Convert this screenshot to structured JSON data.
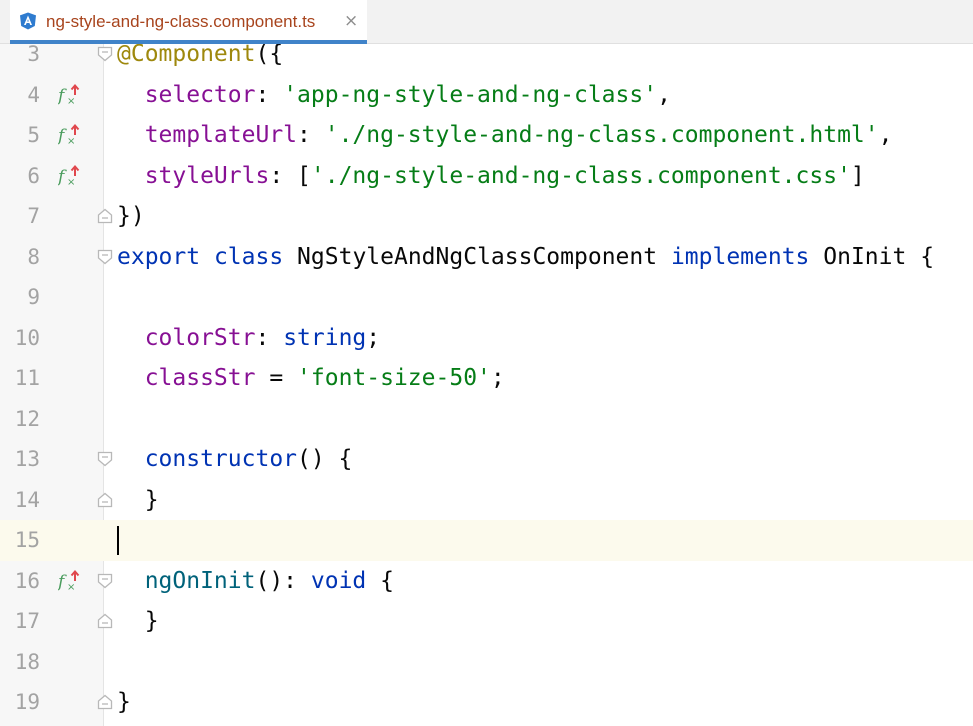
{
  "tab": {
    "filename": "ng-style-and-ng-class.component.ts",
    "close_glyph": "×",
    "icon": "angular-icon",
    "accent": "#4083c9"
  },
  "editor": {
    "current_line": 15,
    "lines": [
      {
        "num": "3",
        "tokens": [
          {
            "t": "@Component",
            "c": "annot"
          },
          {
            "t": "({",
            "c": "plain"
          }
        ]
      },
      {
        "num": "4",
        "tokens": [
          {
            "t": "  selector",
            "c": "key"
          },
          {
            "t": ": ",
            "c": "plain"
          },
          {
            "t": "'app-ng-style-and-ng-class'",
            "c": "str"
          },
          {
            "t": ",",
            "c": "plain"
          }
        ]
      },
      {
        "num": "5",
        "tokens": [
          {
            "t": "  templateUrl",
            "c": "key"
          },
          {
            "t": ": ",
            "c": "plain"
          },
          {
            "t": "'./ng-style-and-ng-class.component.html'",
            "c": "str"
          },
          {
            "t": ",",
            "c": "plain"
          }
        ]
      },
      {
        "num": "6",
        "tokens": [
          {
            "t": "  styleUrls",
            "c": "key"
          },
          {
            "t": ": [",
            "c": "plain"
          },
          {
            "t": "'./ng-style-and-ng-class.component.css'",
            "c": "str"
          },
          {
            "t": "]",
            "c": "plain"
          }
        ]
      },
      {
        "num": "7",
        "tokens": [
          {
            "t": "})",
            "c": "plain"
          }
        ]
      },
      {
        "num": "8",
        "tokens": [
          {
            "t": "export",
            "c": "kw"
          },
          {
            "t": " ",
            "c": "plain"
          },
          {
            "t": "class",
            "c": "kw"
          },
          {
            "t": " NgStyleAndNgClassComponent ",
            "c": "plain"
          },
          {
            "t": "implements",
            "c": "kw"
          },
          {
            "t": " OnInit {",
            "c": "plain"
          }
        ]
      },
      {
        "num": "9",
        "tokens": []
      },
      {
        "num": "10",
        "tokens": [
          {
            "t": "  colorStr",
            "c": "key"
          },
          {
            "t": ": ",
            "c": "plain"
          },
          {
            "t": "string",
            "c": "kw"
          },
          {
            "t": ";",
            "c": "plain"
          }
        ]
      },
      {
        "num": "11",
        "tokens": [
          {
            "t": "  classStr",
            "c": "key"
          },
          {
            "t": " = ",
            "c": "plain"
          },
          {
            "t": "'font-size-50'",
            "c": "str"
          },
          {
            "t": ";",
            "c": "plain"
          }
        ]
      },
      {
        "num": "12",
        "tokens": []
      },
      {
        "num": "13",
        "tokens": [
          {
            "t": "  constructor",
            "c": "kw"
          },
          {
            "t": "() {",
            "c": "plain"
          }
        ]
      },
      {
        "num": "14",
        "tokens": [
          {
            "t": "  }",
            "c": "plain"
          }
        ]
      },
      {
        "num": "15",
        "tokens": []
      },
      {
        "num": "16",
        "tokens": [
          {
            "t": "  ngOnInit",
            "c": "fn"
          },
          {
            "t": "(): ",
            "c": "plain"
          },
          {
            "t": "void",
            "c": "kw"
          },
          {
            "t": " {",
            "c": "plain"
          }
        ]
      },
      {
        "num": "17",
        "tokens": [
          {
            "t": "  }",
            "c": "plain"
          }
        ]
      },
      {
        "num": "18",
        "tokens": []
      },
      {
        "num": "19",
        "tokens": [
          {
            "t": "}",
            "c": "plain"
          }
        ]
      }
    ],
    "implements_icon_lines": [
      4,
      5,
      6,
      16
    ],
    "fold_open_lines": [
      3,
      8,
      13,
      16
    ],
    "fold_close_lines": [
      7,
      14,
      17,
      19
    ]
  }
}
